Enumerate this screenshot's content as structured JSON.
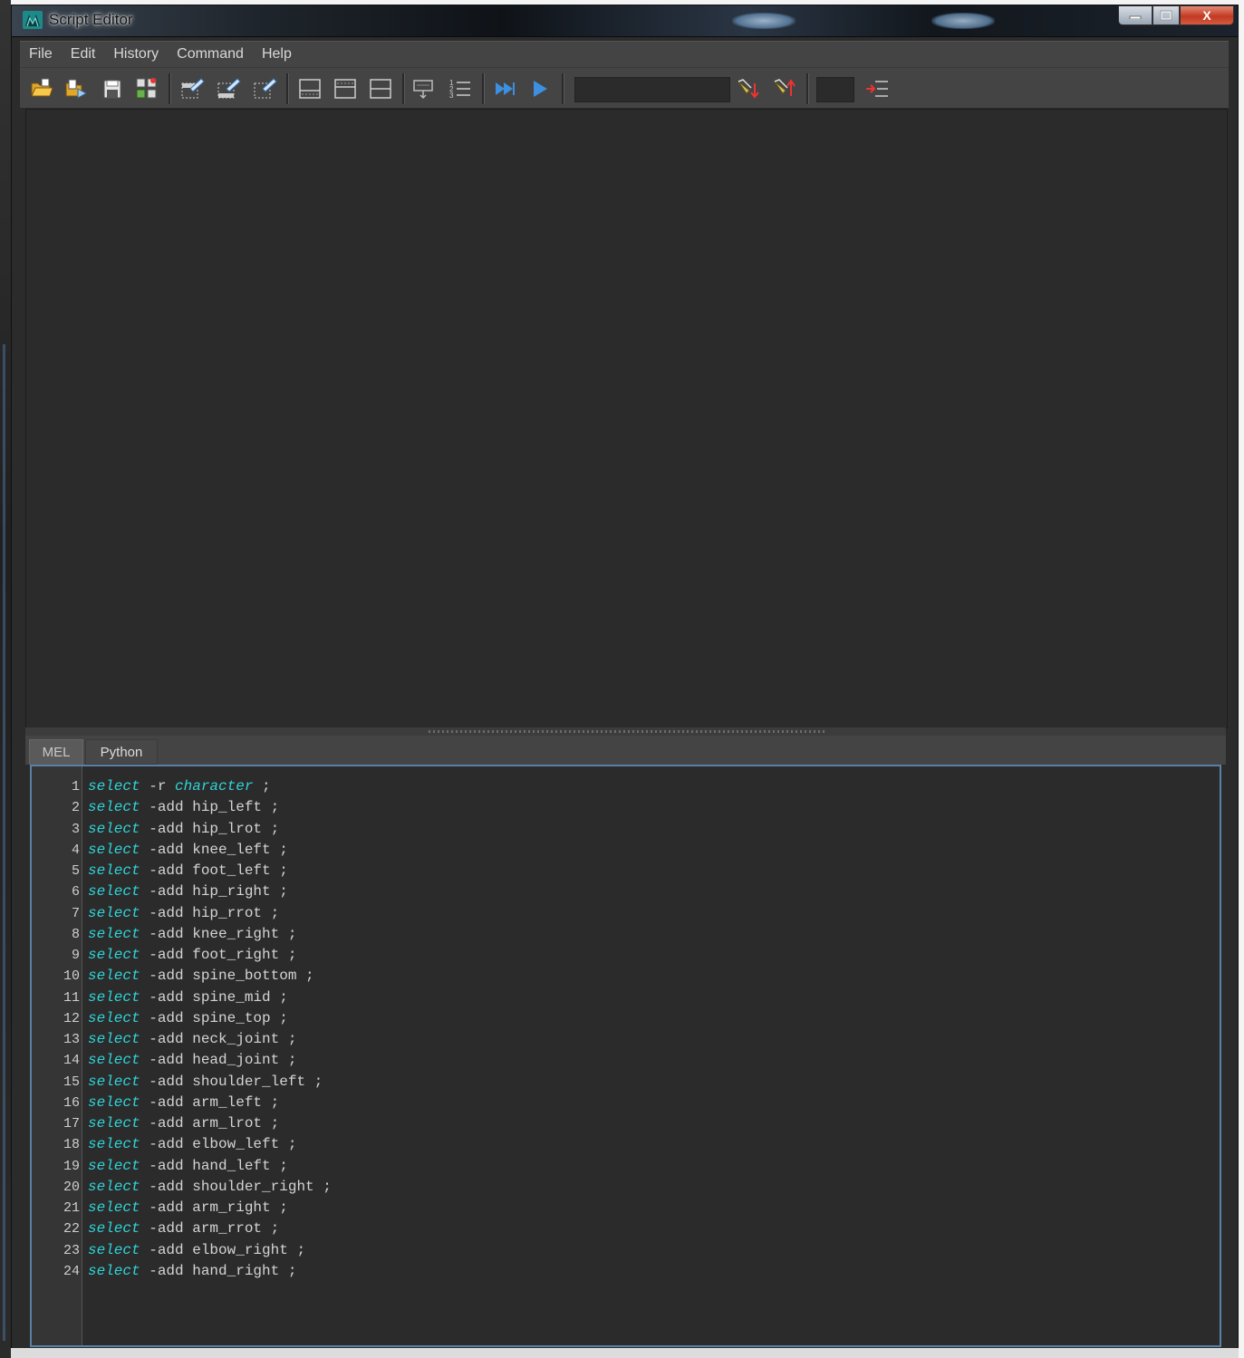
{
  "window": {
    "title": "Script Editor",
    "close_glyph": "X"
  },
  "menu": [
    "File",
    "Edit",
    "History",
    "Command",
    "Help"
  ],
  "toolbar": {
    "icons": [
      "open-script-icon",
      "source-script-icon",
      "save-script-icon",
      "save-to-shelf-icon",
      "clear-history-icon",
      "clear-input-icon",
      "clear-all-icon",
      "show-history-only-icon",
      "show-input-only-icon",
      "show-both-icon",
      "echo-all-commands-icon",
      "line-numbers-icon",
      "execute-all-icon",
      "execute-icon",
      "search-icon",
      "search-down-icon",
      "search-up-icon",
      "goto-line-icon"
    ]
  },
  "tabs": {
    "mel": "MEL",
    "python": "Python"
  },
  "colors": {
    "keyword": "#2fd4d8",
    "text": "#d4d4d4",
    "editor_border": "#5a80a6"
  },
  "code": {
    "lines": [
      {
        "n": "1",
        "kw": "select",
        "rest": " -r ",
        "kw2": "character",
        "tail": " ;"
      },
      {
        "n": "2",
        "kw": "select",
        "rest": " -add hip_left ;"
      },
      {
        "n": "3",
        "kw": "select",
        "rest": " -add hip_lrot ;"
      },
      {
        "n": "4",
        "kw": "select",
        "rest": " -add knee_left ;"
      },
      {
        "n": "5",
        "kw": "select",
        "rest": " -add foot_left ;"
      },
      {
        "n": "6",
        "kw": "select",
        "rest": " -add hip_right ;"
      },
      {
        "n": "7",
        "kw": "select",
        "rest": " -add hip_rrot ;"
      },
      {
        "n": "8",
        "kw": "select",
        "rest": " -add knee_right ;"
      },
      {
        "n": "9",
        "kw": "select",
        "rest": " -add foot_right ;"
      },
      {
        "n": "10",
        "kw": "select",
        "rest": " -add spine_bottom ;"
      },
      {
        "n": "11",
        "kw": "select",
        "rest": " -add spine_mid ;"
      },
      {
        "n": "12",
        "kw": "select",
        "rest": " -add spine_top ;"
      },
      {
        "n": "13",
        "kw": "select",
        "rest": " -add neck_joint ;"
      },
      {
        "n": "14",
        "kw": "select",
        "rest": " -add head_joint ;"
      },
      {
        "n": "15",
        "kw": "select",
        "rest": " -add shoulder_left ;"
      },
      {
        "n": "16",
        "kw": "select",
        "rest": " -add arm_left ;"
      },
      {
        "n": "17",
        "kw": "select",
        "rest": " -add arm_lrot ;"
      },
      {
        "n": "18",
        "kw": "select",
        "rest": " -add elbow_left ;"
      },
      {
        "n": "19",
        "kw": "select",
        "rest": " -add hand_left ;"
      },
      {
        "n": "20",
        "kw": "select",
        "rest": " -add shoulder_right ;"
      },
      {
        "n": "21",
        "kw": "select",
        "rest": " -add arm_right ;"
      },
      {
        "n": "22",
        "kw": "select",
        "rest": " -add arm_rrot ;"
      },
      {
        "n": "23",
        "kw": "select",
        "rest": " -add elbow_right ;"
      },
      {
        "n": "24",
        "kw": "select",
        "rest": " -add hand_right ;"
      }
    ]
  }
}
